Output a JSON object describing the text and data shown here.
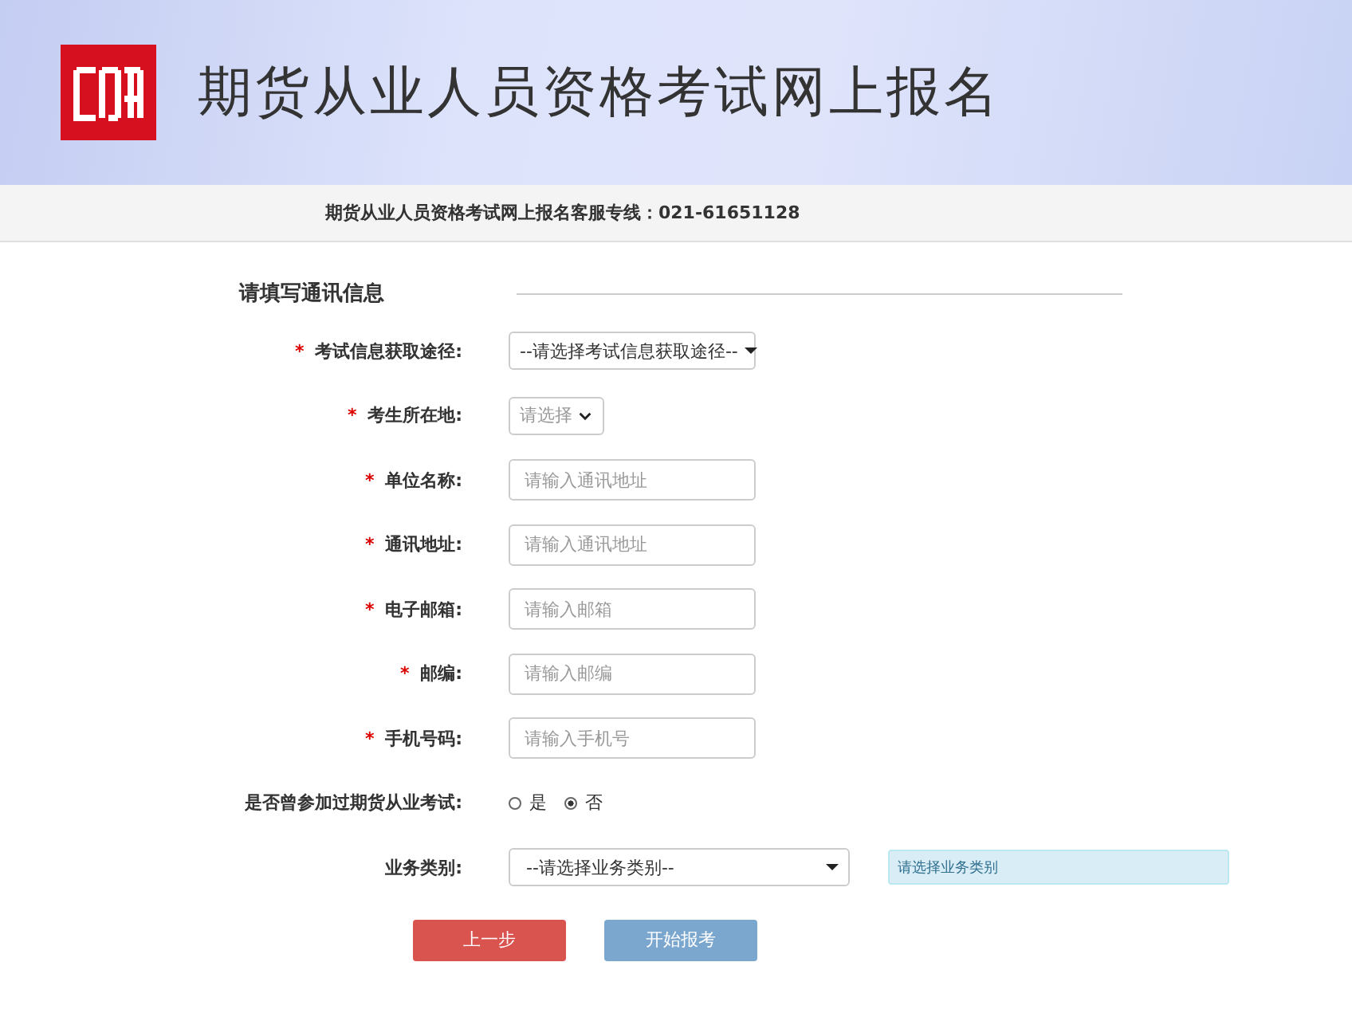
{
  "header": {
    "title": "期货从业人员资格考试网上报名"
  },
  "hotline": "期货从业人员资格考试网上报名客服专线：021-61651128",
  "section_title": "请填写通讯信息",
  "fields": [
    {
      "kind": "select",
      "required_mark": "*",
      "label": "考试信息获取途径:",
      "value": "--请选择考试信息获取途径--"
    },
    {
      "kind": "select_small",
      "required_mark": "*",
      "label": "考生所在地:",
      "placeholder": "请选择"
    },
    {
      "kind": "input",
      "required_mark": "*",
      "label": "单位名称:",
      "placeholder": "请输入通讯地址"
    },
    {
      "kind": "input",
      "required_mark": "*",
      "label": "通讯地址:",
      "placeholder": "请输入通讯地址"
    },
    {
      "kind": "input",
      "required_mark": "*",
      "label": "电子邮箱:",
      "placeholder": "请输入邮箱"
    },
    {
      "kind": "input",
      "required_mark": "*",
      "label": "邮编:",
      "placeholder": "请输入邮编"
    },
    {
      "kind": "input",
      "required_mark": "*",
      "label": "手机号码:",
      "placeholder": "请输入手机号"
    },
    {
      "kind": "radio",
      "label": "是否曾参加过期货从业考试:",
      "options": [
        {
          "label": "是",
          "selected": false
        },
        {
          "label": "否",
          "selected": true
        }
      ]
    },
    {
      "kind": "select_wide",
      "label": "业务类别:",
      "value": "--请选择业务类别--",
      "hint": "请选择业务类别"
    }
  ],
  "buttons": [
    {
      "label": "上一步",
      "kind": "back"
    },
    {
      "label": "开始报考",
      "kind": "start"
    }
  ]
}
